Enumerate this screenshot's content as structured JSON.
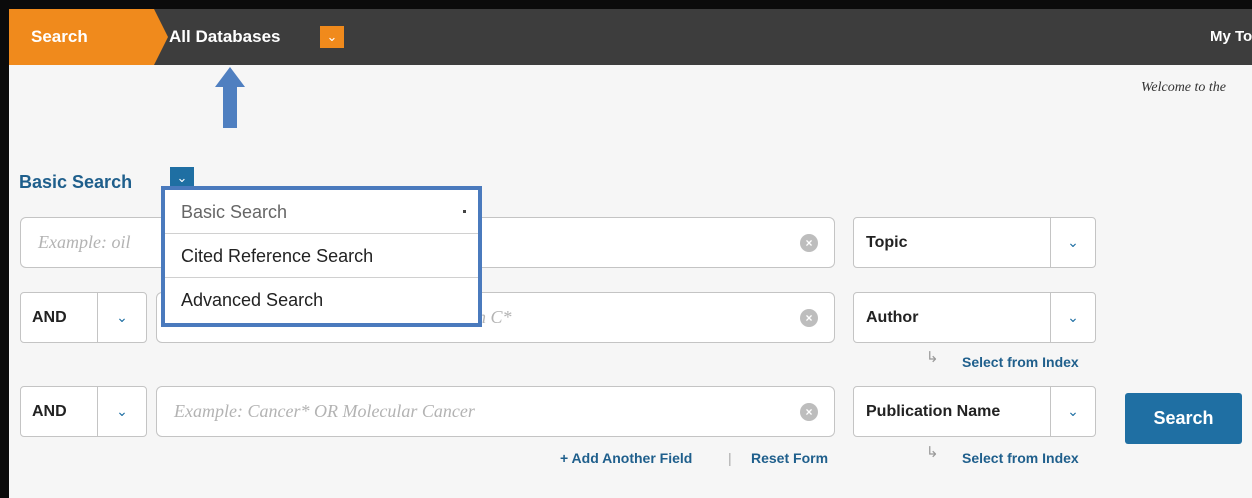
{
  "topbar": {
    "search_tab": "Search",
    "database_label": "All Databases",
    "database_toggle_icon": "chevron-down-icon",
    "my_tools": "My Tools"
  },
  "welcome_text": "Welcome to the",
  "basic_search": {
    "title": "Basic Search",
    "menu": [
      {
        "label": "Basic Search"
      },
      {
        "label": "Cited Reference Search"
      },
      {
        "label": "Advanced Search"
      }
    ]
  },
  "rows": [
    {
      "operator": null,
      "placeholder": "Example: oil",
      "field": "Topic"
    },
    {
      "operator": "AND",
      "placeholder": "n C*",
      "field": "Author",
      "index_link": "Select from Index"
    },
    {
      "operator": "AND",
      "placeholder": "Example: Cancer* OR Molecular Cancer",
      "field": "Publication Name",
      "index_link": "Select from Index"
    }
  ],
  "actions": {
    "search_button": "Search",
    "add_field": "+ Add Another Field",
    "separator": "|",
    "reset_form": "Reset Form"
  },
  "colors": {
    "accent_orange": "#f08a1c",
    "nav_dark": "#3d3d3d",
    "link_blue": "#1f5f8c",
    "button_blue": "#1f6fa3",
    "annotation_blue": "#4a7abd"
  }
}
